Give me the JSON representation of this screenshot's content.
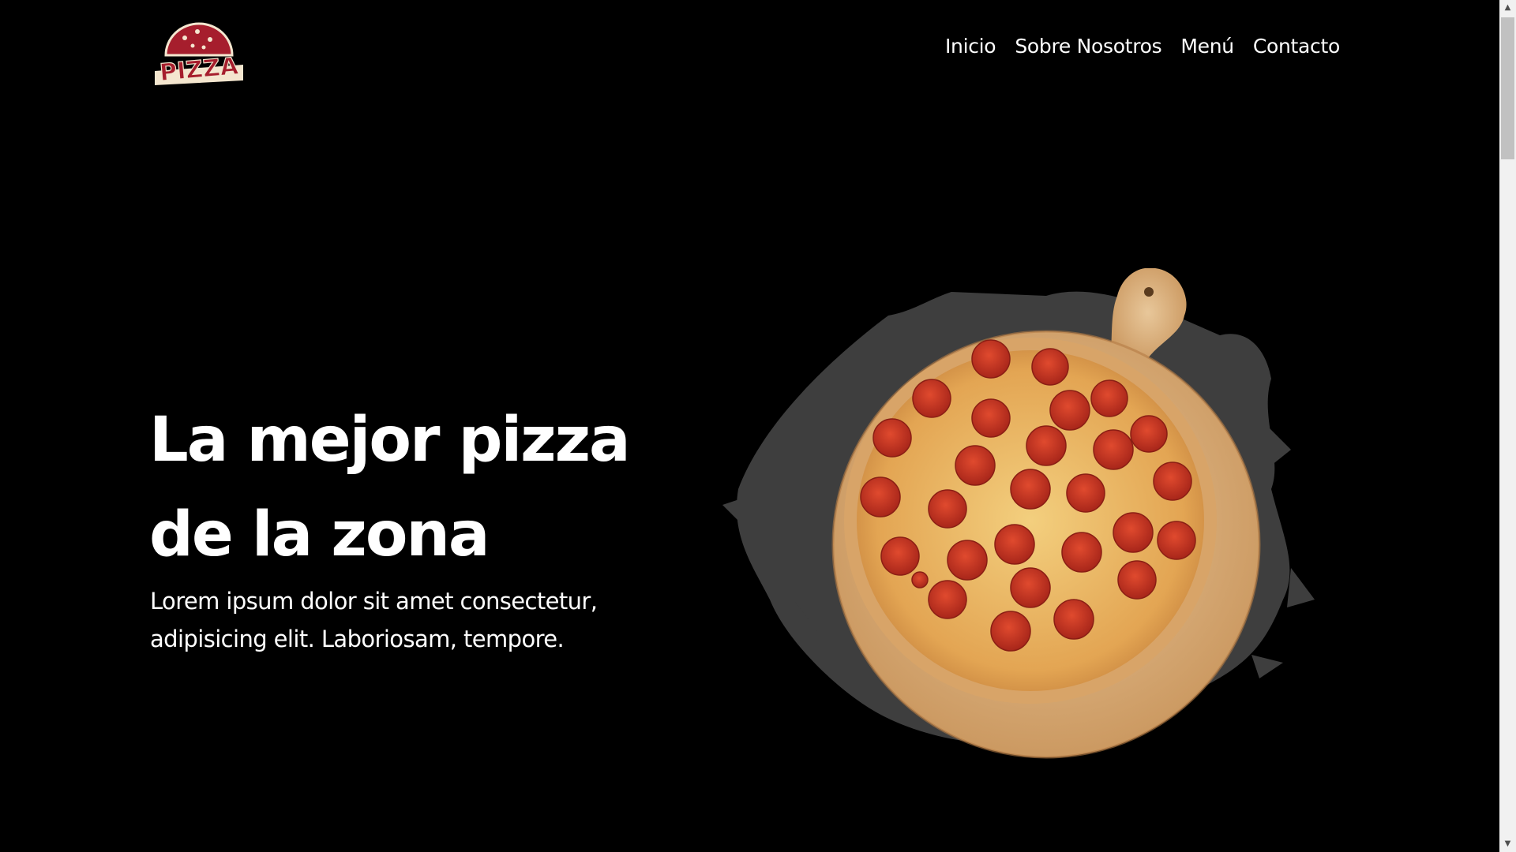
{
  "brand": {
    "logo_text": "PIZZA",
    "colors": {
      "logo_red": "#a61e2d",
      "logo_cream": "#f4e6cf",
      "background": "#000000",
      "text": "#ffffff"
    }
  },
  "nav": {
    "items": [
      {
        "label": "Inicio"
      },
      {
        "label": "Sobre Nosotros"
      },
      {
        "label": "Menú"
      },
      {
        "label": "Contacto"
      }
    ]
  },
  "hero": {
    "title_line1": "La mejor pizza",
    "title_line2": "de la zona",
    "text": "Lorem ipsum dolor sit amet consectetur, adipisicing elit. Laboriosam, tempore.",
    "image_icon": "pepperoni-pizza-on-wooden-board"
  },
  "scrollbar": {
    "up_icon": "chevron-up-icon",
    "down_icon": "chevron-down-icon"
  }
}
